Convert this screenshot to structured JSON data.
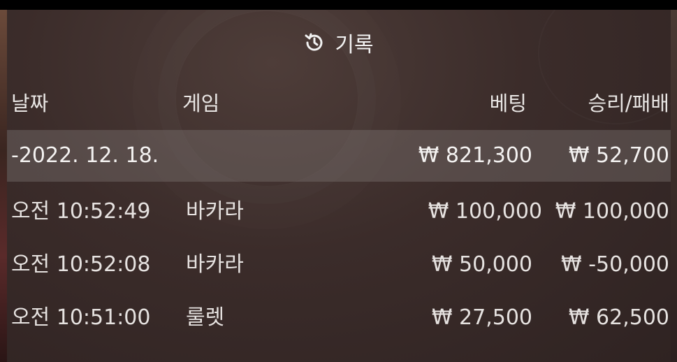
{
  "panel": {
    "title": "기록",
    "title_icon": "history-icon"
  },
  "table": {
    "headers": {
      "date": "날짜",
      "game": "게임",
      "bet": "베팅",
      "win_loss": "승리/패배"
    },
    "summary": {
      "date": "-2022. 12. 18.",
      "bet": "₩ 821,300",
      "win_loss": "₩ 52,700"
    },
    "rows": [
      {
        "time": "오전 10:52:49",
        "game": "바카라",
        "bet": "₩ 100,000",
        "win_loss": "₩ 100,000"
      },
      {
        "time": "오전 10:52:08",
        "game": "바카라",
        "bet": "₩ 50,000",
        "win_loss": "₩ -50,000"
      },
      {
        "time": "오전 10:51:00",
        "game": "룰렛",
        "bet": "₩ 27,500",
        "win_loss": "₩ 62,500"
      }
    ]
  },
  "colors": {
    "panel_bg": "#3b2c2a",
    "summary_bg": "#6e6462",
    "text": "#f2f2f2"
  }
}
